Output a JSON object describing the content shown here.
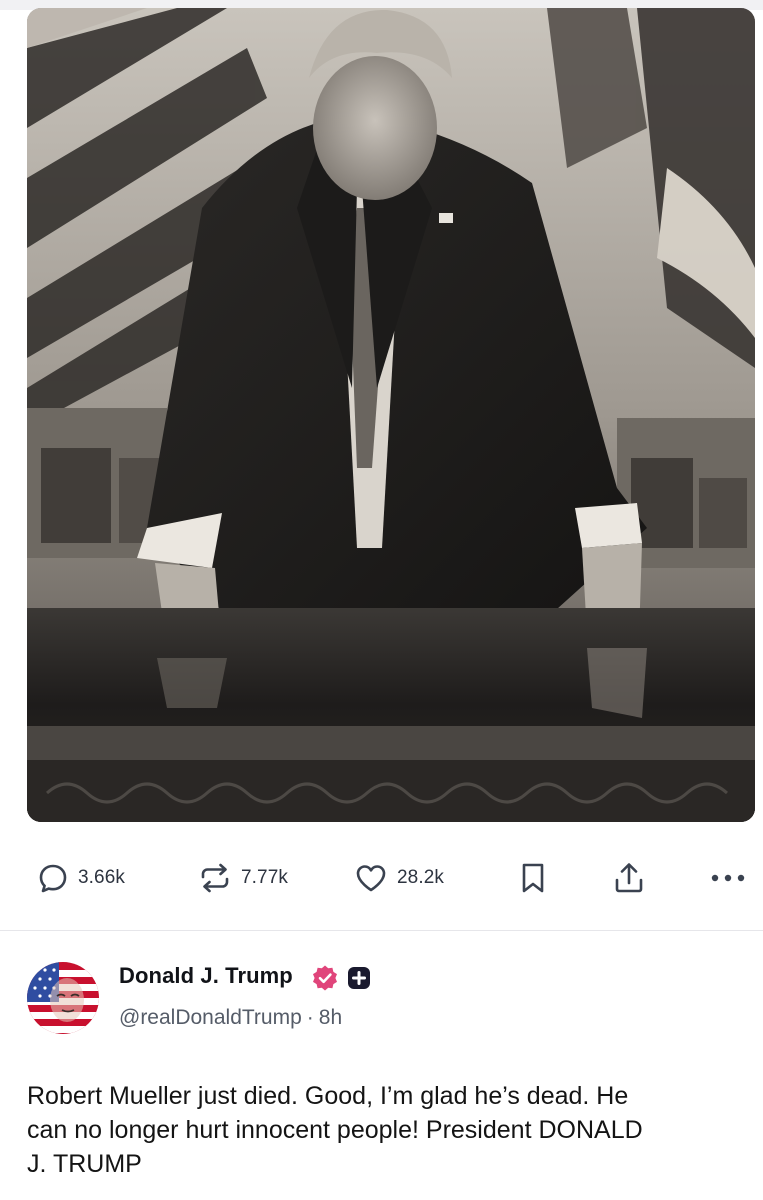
{
  "post_actions": {
    "replies": "3.66k",
    "reposts": "7.77k",
    "likes": "28.2k",
    "icons": {
      "reply": "comment-bubble-icon",
      "repost": "repost-arrows-icon",
      "like": "heart-icon",
      "bookmark": "bookmark-icon",
      "share": "share-upload-icon",
      "more": "more-horizontal-icon"
    }
  },
  "post": {
    "author": {
      "display_name": "Donald J. Trump",
      "handle": "@realDonaldTrump",
      "separator": "·",
      "time_ago": "8h"
    },
    "text": "Robert Mueller just died. Good, I’m glad he’s dead. He\ncan no longer hurt innocent people! President DONALD\nJ. TRUMP"
  },
  "colors": {
    "verified_badge": "#e0457b",
    "plus_badge": "#1a1a2e",
    "action_icon": "#3a4250",
    "divider": "#e6e6ea"
  }
}
